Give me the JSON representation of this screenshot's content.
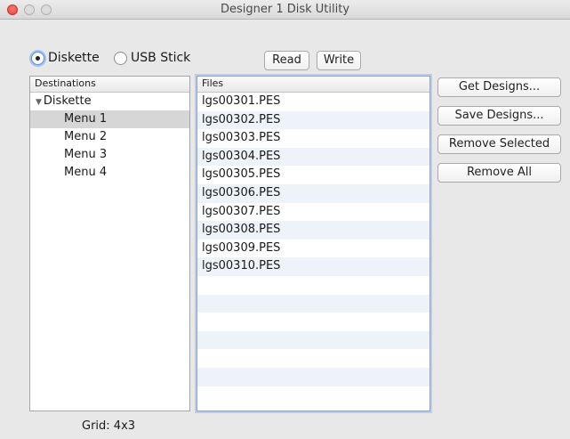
{
  "window": {
    "title": "Designer 1 Disk Utility"
  },
  "source": {
    "options": [
      {
        "label": "Diskette",
        "selected": true
      },
      {
        "label": "USB Stick",
        "selected": false
      }
    ]
  },
  "actions": {
    "read_label": "Read",
    "write_label": "Write"
  },
  "destinations": {
    "header": "Destinations",
    "root": "Diskette",
    "items": [
      "Menu 1",
      "Menu 2",
      "Menu 3",
      "Menu 4"
    ],
    "selected_index": 0
  },
  "files": {
    "header": "Files",
    "items": [
      "lgs00301.PES",
      "lgs00302.PES",
      "lgs00303.PES",
      "lgs00304.PES",
      "lgs00305.PES",
      "lgs00306.PES",
      "lgs00307.PES",
      "lgs00308.PES",
      "lgs00309.PES",
      "lgs00310.PES",
      "",
      "",
      "",
      "",
      "",
      "",
      ""
    ]
  },
  "side_buttons": {
    "get_designs": "Get Designs...",
    "save_designs": "Save Designs...",
    "remove_selected": "Remove Selected",
    "remove_all": "Remove All"
  },
  "status": {
    "grid": "Grid: 4x3"
  }
}
